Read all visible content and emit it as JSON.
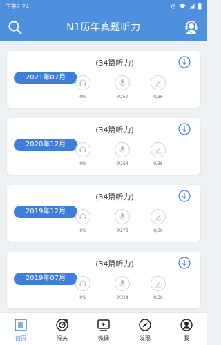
{
  "status_bar": {
    "time": "下午2:24"
  },
  "app_bar": {
    "title": "N1历年真题听力"
  },
  "cards": [
    {
      "date": "2021年07月",
      "count": "(34篇听力)",
      "stats": [
        "0%",
        "0/267",
        "0/36"
      ]
    },
    {
      "date": "2020年12月",
      "count": "(34篇听力)",
      "stats": [
        "0%",
        "0/264",
        "0/36"
      ]
    },
    {
      "date": "2019年12月",
      "count": "(34篇听力)",
      "stats": [
        "0%",
        "0/273",
        "0/36"
      ]
    },
    {
      "date": "2019年07月",
      "count": "(34篇听力)",
      "stats": [
        "0%",
        "0/324",
        "0/36"
      ]
    }
  ],
  "tabs": [
    {
      "label": "首页",
      "icon": "home-list-icon",
      "active": true
    },
    {
      "label": "闯关",
      "icon": "target-icon",
      "active": false
    },
    {
      "label": "微课",
      "icon": "video-icon",
      "active": false
    },
    {
      "label": "发现",
      "icon": "compass-icon",
      "active": false
    },
    {
      "label": "我",
      "icon": "person-icon",
      "active": false
    }
  ],
  "colors": {
    "primary": "#4d90de",
    "badge": "#3f7fda",
    "background": "#eef1f4"
  }
}
